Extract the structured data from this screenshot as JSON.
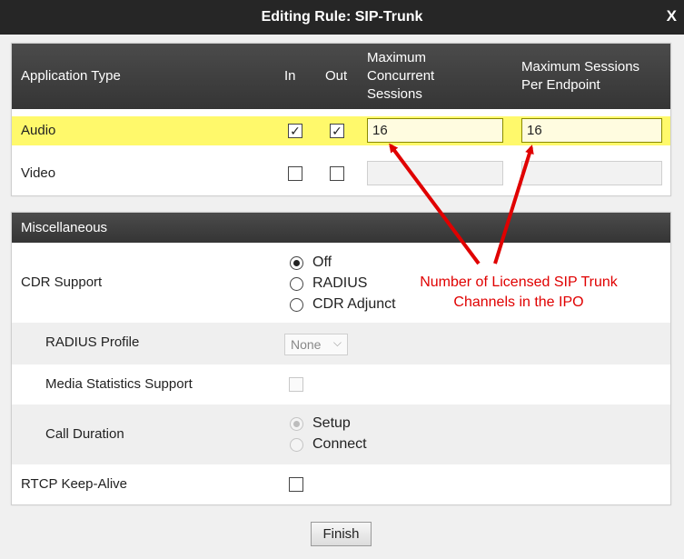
{
  "window": {
    "title": "Editing Rule: SIP-Trunk",
    "close_label": "X"
  },
  "app_table": {
    "headers": {
      "application_type": "Application Type",
      "in": "In",
      "out": "Out",
      "max_concurrent": [
        "Maximum",
        "Concurrent",
        "Sessions"
      ],
      "max_per_endpoint": [
        "Maximum Sessions",
        "Per Endpoint"
      ]
    },
    "rows": [
      {
        "label": "Audio",
        "in": true,
        "out": true,
        "max_concurrent": "16",
        "max_per_endpoint": "16",
        "highlighted": true
      },
      {
        "label": "Video",
        "in": false,
        "out": false,
        "max_concurrent": "",
        "max_per_endpoint": "",
        "highlighted": false
      }
    ]
  },
  "misc": {
    "header": "Miscellaneous",
    "cdr_support": {
      "label": "CDR Support",
      "options": [
        "Off",
        "RADIUS",
        "CDR Adjunct"
      ],
      "selected": "Off"
    },
    "radius_profile": {
      "label": "RADIUS Profile",
      "value": "None"
    },
    "media_stats": {
      "label": "Media Statistics Support",
      "checked": false
    },
    "call_duration": {
      "label": "Call Duration",
      "options": [
        "Setup",
        "Connect"
      ],
      "selected": "Setup"
    },
    "rtcp_keepalive": {
      "label": "RTCP Keep-Alive",
      "checked": false
    }
  },
  "annotation": {
    "text": [
      "Number of Licensed SIP Trunk",
      "Channels in the IPO"
    ],
    "color": "#e00000"
  },
  "footer": {
    "finish_label": "Finish"
  },
  "icons": {
    "checkmark": "check-icon",
    "close": "close-icon",
    "dropdown": "chevron-down-icon"
  }
}
